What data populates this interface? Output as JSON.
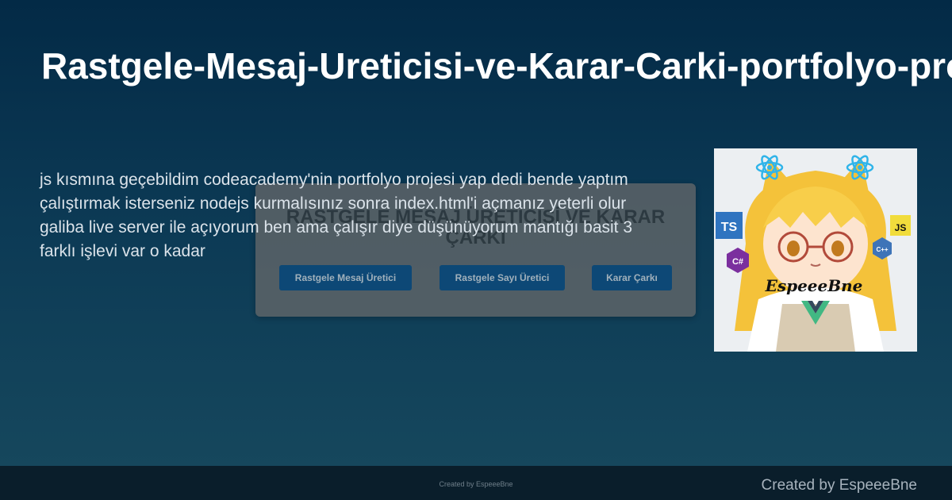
{
  "title": "Rastgele-Mesaj-Ureticisi-ve-Karar-Carki-portfolyo-projesi",
  "description": "js kısmına geçebildim codeacademy'nin portfolyo projesi yap dedi bende yaptım çalıştırmak isterseniz nodejs kurmalısınız sonra index.html'i açmanız yeterli olur galiba live server ile açıyorum ben ama çalışır diye düşünüyorum mantığı basit 3 farklı işlevi var o kadar",
  "preview": {
    "heading": "RASTGELE MESAJ ÜRETİCİSİ VE KARAR ÇARKI",
    "buttons": [
      "Rastgele Mesaj Üretici",
      "Rastgele Sayı Üretici",
      "Karar Çarkı"
    ],
    "footer": "Created by EspeeeBne"
  },
  "avatar": {
    "name": "EspeeeBne",
    "badges": [
      "TS",
      "JS",
      "C#",
      "C++"
    ]
  },
  "footer": {
    "credit": "Created by EspeeeBne"
  },
  "colors": {
    "background_top": "#032a46",
    "background_bottom": "#17495e",
    "preview_button": "#0d4d82",
    "footer": "#0a1e2b"
  }
}
